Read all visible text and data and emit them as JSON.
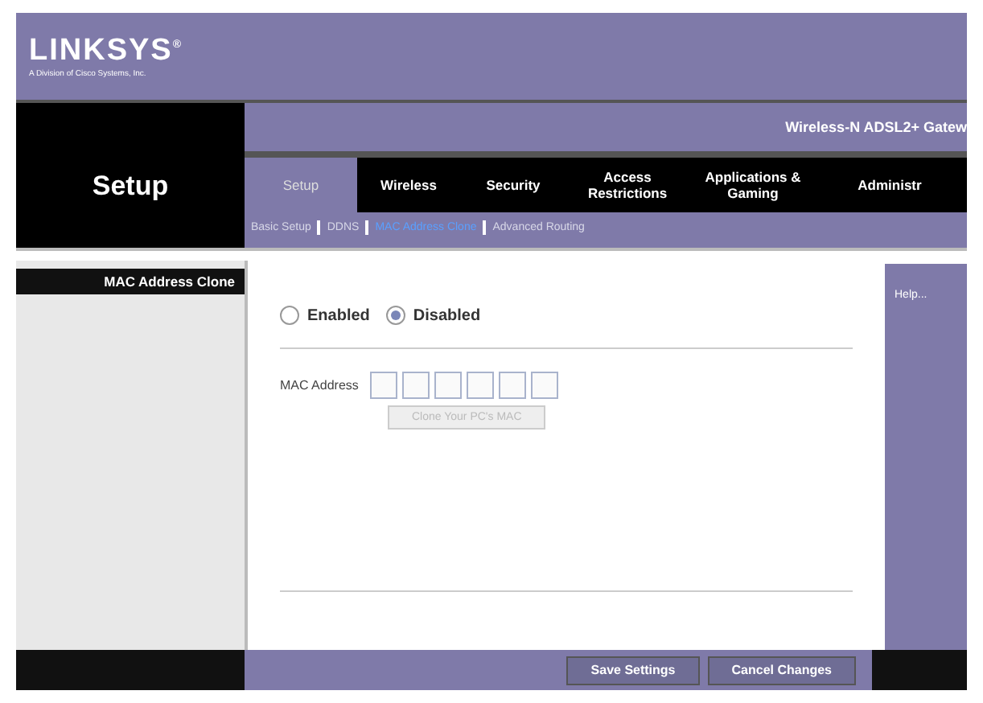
{
  "logo": {
    "name": "LINKSYS$^{®}$",
    "tagline": "A Division of Cisco Systems, Inc."
  },
  "section_title": "Setup",
  "product_name": "Wireless-N ADSL2+ Gatew",
  "tabs": [
    {
      "label": "Setup",
      "selected": true
    },
    {
      "label": "Wireless",
      "selected": false
    },
    {
      "label": "Security",
      "selected": false
    },
    {
      "label": "Access Restrictions",
      "selected": false
    },
    {
      "label": "Applications & Gaming",
      "selected": false
    },
    {
      "label": "Administr",
      "selected": false
    }
  ],
  "subtabs": [
    {
      "label": "Basic Setup",
      "selected": false
    },
    {
      "label": "DDNS",
      "selected": false
    },
    {
      "label": "MAC Address Clone",
      "selected": true
    },
    {
      "label": "Advanced Routing",
      "selected": false
    }
  ],
  "sidebar": {
    "heading": "MAC Address Clone"
  },
  "mac_clone": {
    "options": [
      {
        "label": "Enabled",
        "selected": false
      },
      {
        "label": "Disabled",
        "selected": true
      }
    ],
    "mac_label": "MAC Address",
    "fields": [
      {
        "disabled": true
      },
      {
        "disabled": true
      },
      {
        "disabled": true
      },
      {
        "disabled": true
      },
      {
        "disabled": true
      },
      {
        "disabled": true
      }
    ],
    "clone_button": {
      "label": "Clone Your PC's MAC",
      "disabled": true
    }
  },
  "help": {
    "link": "Help..."
  },
  "buttons": [
    "Save Settings",
    "Cancel Changes"
  ]
}
